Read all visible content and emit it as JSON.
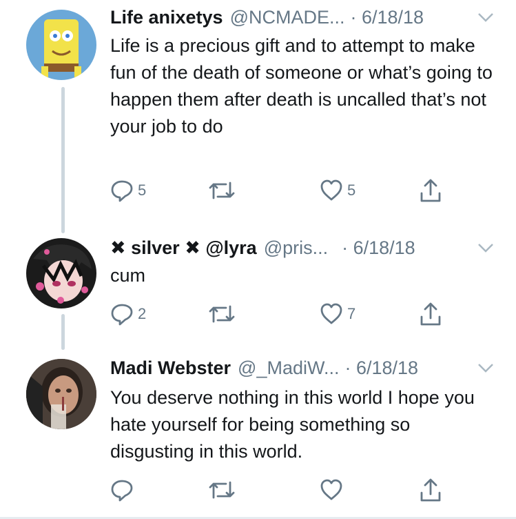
{
  "tweets": [
    {
      "name": "Life anixetys",
      "handle": "@NCMADE...",
      "date": "· 6/18/18",
      "text": "Life is a precious gift and to attempt to make fun of the death of someone or what’s going to happen them after death is uncalled that’s not your job to do",
      "replies": "5",
      "likes": "5",
      "avatar_colors": {
        "bg": "#6ba8d8",
        "face": "#f2e24a"
      }
    },
    {
      "name_prefix": "✖",
      "name_mid": " silver ",
      "name_mid2": "✖",
      "name": " @lyra",
      "handle": "@pris...",
      "date": "· 6/18/18",
      "text": "cum",
      "replies": "2",
      "likes": "7",
      "avatar_colors": {
        "bg": "#1b1b1b",
        "face": "#f4d7d4",
        "accent": "#e05a9a"
      }
    },
    {
      "name": "Madi Webster",
      "handle": "@_MadiW...",
      "date": "· 6/18/18",
      "text": "You deserve nothing in this world I hope you hate yourself for being something so disgusting in this world.",
      "replies": "",
      "likes": "",
      "avatar_colors": {
        "bg": "#6b5a4e",
        "face": "#c89a80"
      }
    }
  ],
  "icons": {
    "reply": "reply-icon",
    "retweet": "retweet-icon",
    "like": "heart-icon",
    "share": "share-icon",
    "more": "chevron-down-icon"
  },
  "colors": {
    "text": "#14171a",
    "muted": "#657786",
    "thread": "#ccd6dd"
  }
}
